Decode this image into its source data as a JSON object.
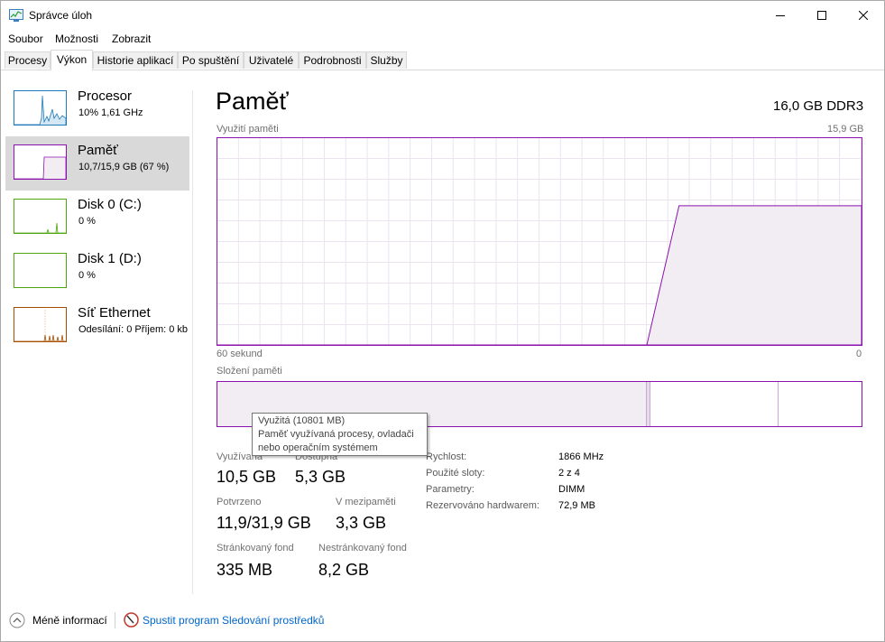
{
  "window": {
    "title": "Správce úloh"
  },
  "menu": [
    "Soubor",
    "Možnosti",
    "Zobrazit"
  ],
  "tabs": [
    "Procesy",
    "Výkon",
    "Historie aplikací",
    "Po spuštění",
    "Uživatelé",
    "Podrobnosti",
    "Služby"
  ],
  "active_tab": "Výkon",
  "sidebar": {
    "items": [
      {
        "name": "Procesor",
        "sub": "10% 1,61 GHz",
        "color": "#1e7ab7"
      },
      {
        "name": "Paměť",
        "sub": "10,7/15,9 GB (67 %)",
        "color": "#8b12ae",
        "selected": true
      },
      {
        "name": "Disk 0 (C:)",
        "sub": "0 %",
        "color": "#4da60c"
      },
      {
        "name": "Disk 1 (D:)",
        "sub": "0 %",
        "color": "#4da60c"
      },
      {
        "name": "Síť Ethernet",
        "sub": "Odesílání: 0 Příjem: 0 kb",
        "color": "#a74f01"
      }
    ]
  },
  "main": {
    "title": "Paměť",
    "spec": "16,0 GB DDR3",
    "usage_label": "Využití paměti",
    "usage_max": "15,9 GB",
    "time_left": "60 sekund",
    "time_right": "0",
    "composition_label": "Složení paměti"
  },
  "tooltip": {
    "title": "Využitá (10801 MB)",
    "line1": "Paměť využívaná procesy, ovladači",
    "line2": "nebo operačním systémem"
  },
  "stats": {
    "in_use_label": "Využívaná",
    "in_use": "10,5 GB",
    "available_label": "Dostupná",
    "available": "5,3 GB",
    "committed_label": "Potvrzeno",
    "committed": "11,9/31,9 GB",
    "cached_label": "V mezipaměti",
    "cached": "3,3 GB",
    "paged_label": "Stránkovaný fond",
    "paged": "335 MB",
    "nonpaged_label": "Nestránkovaný fond",
    "nonpaged": "8,2 GB"
  },
  "specs": [
    {
      "key": "Rychlost:",
      "value": "1866 MHz"
    },
    {
      "key": "Použité sloty:",
      "value": "2 z 4"
    },
    {
      "key": "Parametry:",
      "value": "DIMM"
    },
    {
      "key": "Rezervováno hardwarem:",
      "value": "72,9 MB"
    }
  ],
  "footer": {
    "fewer": "Méně informací",
    "monitor": "Spustit program Sledování prostředků"
  },
  "colors": {
    "memory": "#8b12ae",
    "link": "#0066cc"
  },
  "chart_data": {
    "type": "area",
    "ylim": [
      0,
      15.9
    ],
    "x": [
      60,
      20,
      17,
      10,
      5,
      0
    ],
    "values": [
      0,
      0,
      10.7,
      10.7,
      10.7,
      10.7
    ]
  }
}
